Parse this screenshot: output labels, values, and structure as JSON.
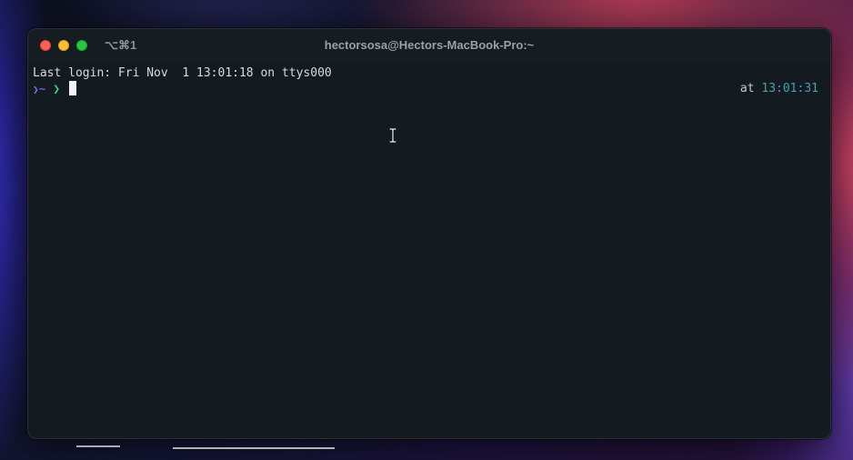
{
  "window": {
    "shortcut": "⌥⌘1",
    "title": "hectorsosa@Hectors-MacBook-Pro:~"
  },
  "terminal": {
    "last_login": "Last login: Fri Nov  1 13:01:18 on ttys000",
    "prompt_path": "~",
    "prompt_symbol": "❯",
    "right_prompt_at": "at",
    "right_prompt_time": "13:01:31"
  },
  "colors": {
    "background": "#131a20",
    "prompt_path": "#6a7cf0",
    "prompt_symbol": "#3fd27a",
    "time": "#4aa3a8",
    "close": "#ff5f57",
    "minimize": "#febc2e",
    "zoom": "#28c840"
  },
  "icons": {
    "cursor": "ibeam-cursor-icon"
  }
}
